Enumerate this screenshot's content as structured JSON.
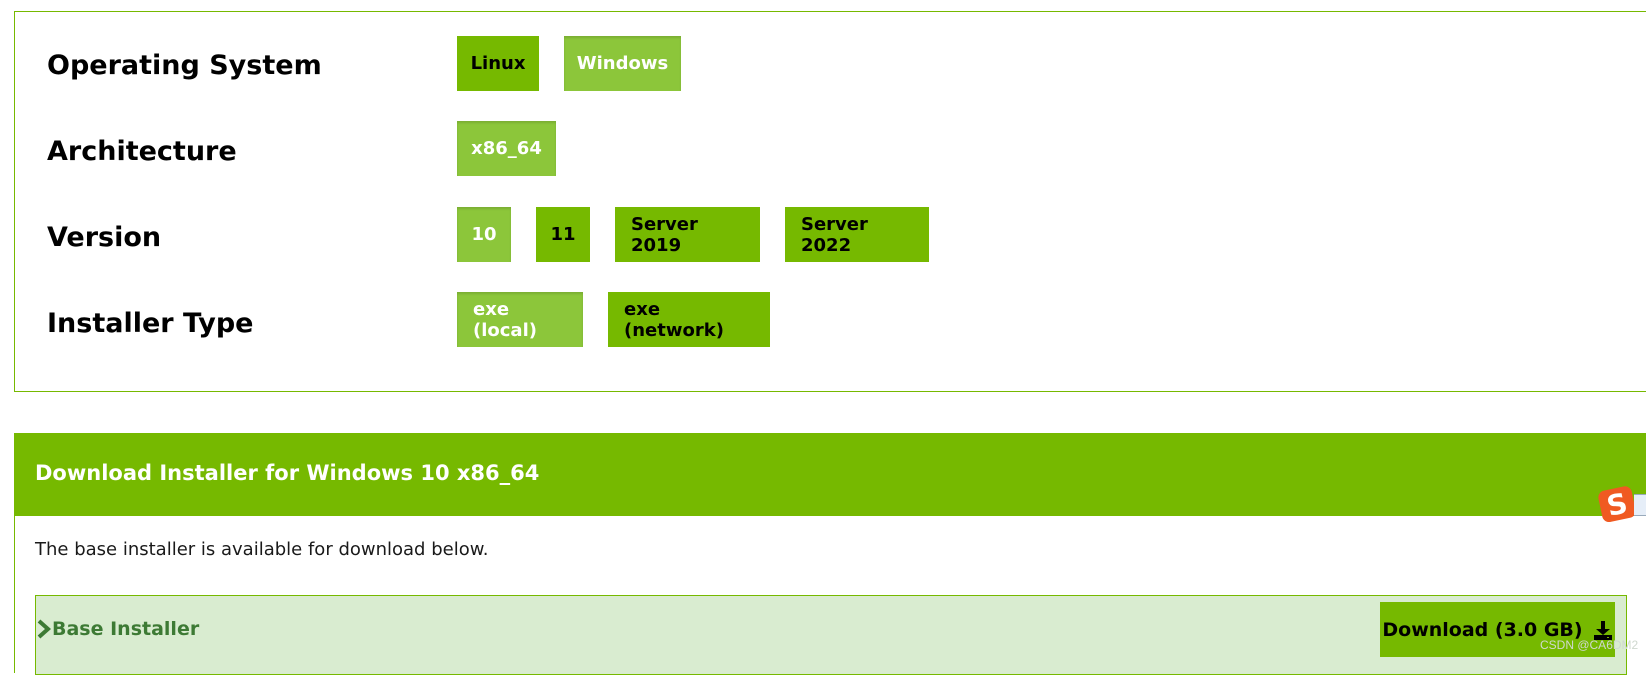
{
  "selector": {
    "rows": [
      {
        "label": "Operating System",
        "options": [
          {
            "label": "Linux",
            "selected": false
          },
          {
            "label": "Windows",
            "selected": true
          }
        ]
      },
      {
        "label": "Architecture",
        "options": [
          {
            "label": "x86_64",
            "selected": true
          }
        ]
      },
      {
        "label": "Version",
        "options": [
          {
            "label": "10",
            "selected": true
          },
          {
            "label": "11",
            "selected": false
          },
          {
            "label": "Server 2019",
            "selected": false
          },
          {
            "label": "Server 2022",
            "selected": false
          }
        ]
      },
      {
        "label": "Installer Type",
        "options": [
          {
            "label": "exe (local)",
            "selected": true
          },
          {
            "label": "exe (network)",
            "selected": false
          }
        ]
      }
    ]
  },
  "download": {
    "title": "Download Installer for Windows 10 x86_64",
    "description": "The base installer is available for download below.",
    "base_installer": {
      "label": "Base Installer",
      "button_label": "Download (3.0 GB)",
      "icon": "download-icon"
    }
  },
  "overlay": {
    "ime_icon": "sogou-ime-icon",
    "watermark": "CSDN @CA6DM2"
  },
  "colors": {
    "accent": "#76b900",
    "selected": "#8cc63a",
    "base_bg": "#d9ecd0",
    "base_text": "#3d7a34"
  }
}
